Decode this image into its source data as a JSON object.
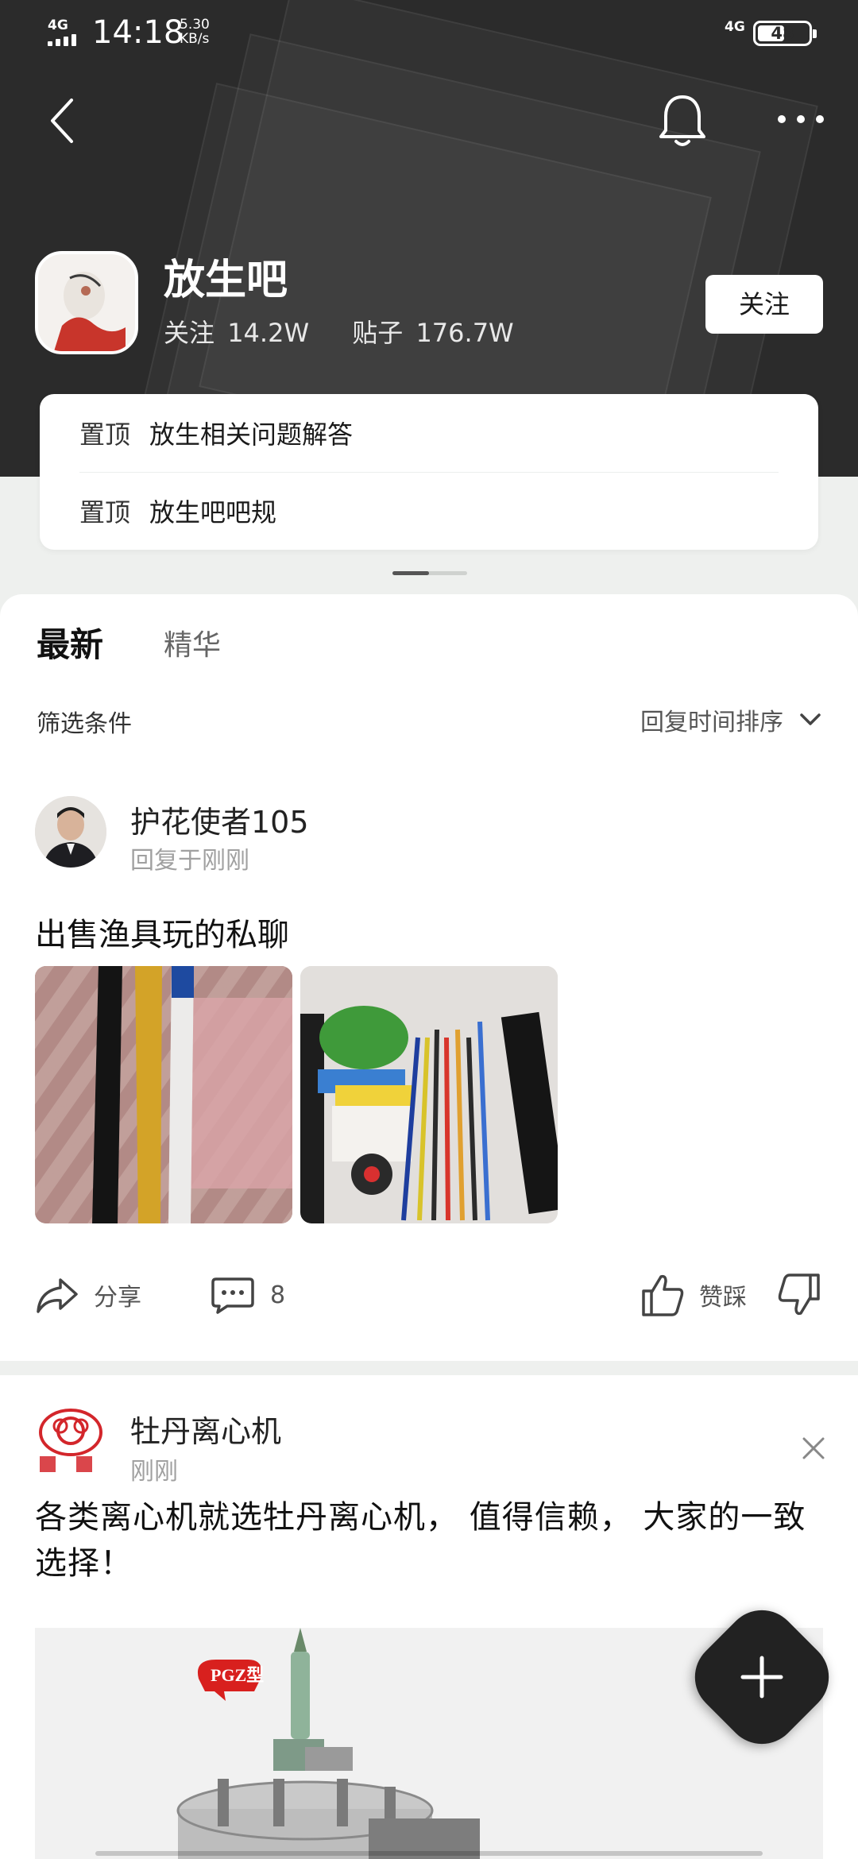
{
  "status_bar": {
    "network_left": "4G",
    "time": "14:18",
    "speed_value": "5.30",
    "speed_unit": "KB/s",
    "network_right": "4G",
    "battery": "48"
  },
  "forum": {
    "name": "放生吧",
    "follow_label": "关注",
    "followers_value": "14.2W",
    "posts_label": "贴子",
    "posts_value": "176.7W",
    "follow_button": "关注"
  },
  "pinned": [
    {
      "tag": "置顶",
      "title": "放生相关问题解答"
    },
    {
      "tag": "置顶",
      "title": "放生吧吧规"
    }
  ],
  "tabs": [
    {
      "label": "最新",
      "active": true
    },
    {
      "label": "精华",
      "active": false
    }
  ],
  "filter": {
    "label": "筛选条件",
    "sort_label": "回复时间排序"
  },
  "post": {
    "author": "护花使者105",
    "time": "回复于刚刚",
    "title": "出售渔具玩的私聊",
    "share_label": "分享",
    "comment_count": "8",
    "vote_label": "赞踩"
  },
  "ad": {
    "name": "牡丹离心机",
    "time": "刚刚",
    "text": "各类离心机就选牡丹离心机， 值得信赖， 大家的一致选择！",
    "image_tag": "PGZ型"
  },
  "colors": {
    "header_bg": "#2b2b2b",
    "page_bg": "#eef0ee",
    "fab_bg": "#222222",
    "secondary_text": "#a0a0a0"
  }
}
